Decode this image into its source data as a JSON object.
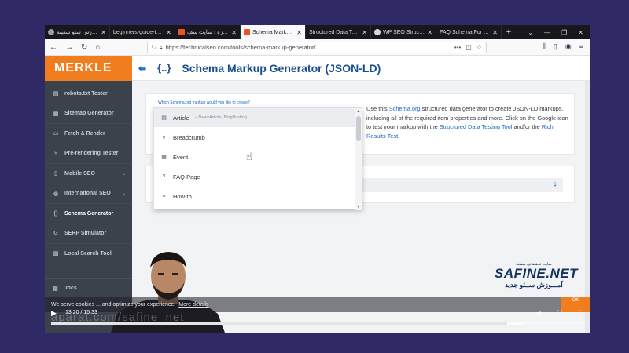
{
  "browser": {
    "tabs": [
      {
        "label": "آموزش سئو سفینه",
        "icon": "chrome-icon",
        "active": false
      },
      {
        "label": "beginners-guide-to-seo",
        "icon": "",
        "active": false
      },
      {
        "label": "برگه‌ی تازه ‹ سایت سف",
        "icon": "orange-s-icon",
        "active": false
      },
      {
        "label": "Schema Markup Ge",
        "icon": "orange-m-icon",
        "active": true
      },
      {
        "label": "Structured Data Testing",
        "icon": "",
        "active": false
      },
      {
        "label": "WP SEO Structured",
        "icon": "wordpress-icon",
        "active": false
      },
      {
        "label": "FAQ Schema For Pa",
        "icon": "",
        "active": false
      }
    ],
    "url": "https://technicalseo.com/tools/schema-markup-generator/"
  },
  "sidebar": {
    "logo": "MERKLE",
    "items": [
      {
        "label": "robots.txt Tester",
        "icon": "document-icon"
      },
      {
        "label": "Sitemap Generator",
        "icon": "sitemap-icon"
      },
      {
        "label": "Fetch & Render",
        "icon": "monitor-icon"
      },
      {
        "label": "Pre-rendering Tester",
        "icon": "fork-icon"
      },
      {
        "label": "Mobile SEO",
        "icon": "mobile-icon"
      },
      {
        "label": "International SEO",
        "icon": "globe-icon"
      },
      {
        "label": "Schema Generator",
        "icon": "braces-icon"
      },
      {
        "label": "SERP Simulator",
        "icon": "google-icon"
      },
      {
        "label": "Local Search Tool",
        "icon": "map-icon"
      }
    ],
    "docs": "Docs"
  },
  "header": {
    "title": "Schema Markup Generator (JSON-LD)",
    "icon": "{..}"
  },
  "main": {
    "question": "Which Schema.org markup would you like to create?",
    "desc_1": "Use this ",
    "desc_link_1": "Schema.org",
    "desc_2": " structured data generator to create JSON-LD markups, including all of the required item properties and more. Click on the Google icon to test your markup with the ",
    "desc_link_2": "Structured Data Testing Tool",
    "desc_3": " and/or the ",
    "desc_link_3": "Rich Results Test",
    "desc_4": "."
  },
  "dropdown": {
    "items": [
      {
        "label": "Article",
        "sub": "– NewsArticle, BlogPosting",
        "icon": "newspaper-icon"
      },
      {
        "label": "Breadcrumb",
        "sub": "",
        "icon": "chevrons-icon"
      },
      {
        "label": "Event",
        "sub": "",
        "icon": "calendar-icon"
      },
      {
        "label": "FAQ Page",
        "sub": "",
        "icon": "question-icon"
      },
      {
        "label": "How-to",
        "sub": "",
        "icon": "list-icon"
      }
    ]
  },
  "watermark": {
    "small": "سایت تحقیقاتی سفینه",
    "brand": "SAFINE.NET",
    "tagline": "آمـــوزش ســئو جدید"
  },
  "overlay": {
    "cookie_text": "We serve cookies ... and optimize your experience.",
    "cookie_more": "More details",
    "aparat": "aparat.com/safine_net",
    "orange_label": "OK"
  },
  "player": {
    "time": "13:20 / 15:33",
    "progress": 0.857
  }
}
